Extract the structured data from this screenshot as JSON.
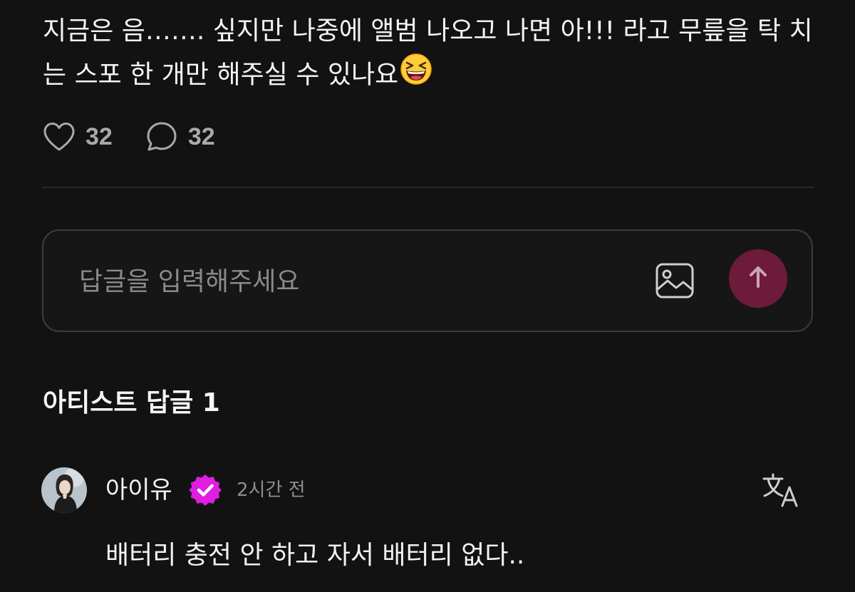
{
  "post": {
    "text": "지금은 음……. 싶지만 나중에 앨범 나오고 나면 아!!! 라고 무릎을 탁 치는  스포 한 개만 해주실 수 있나요",
    "emoji": "grinning-squinting-face-emoji"
  },
  "reactions": {
    "likes": "32",
    "comments": "32",
    "like_icon": "heart-icon",
    "comment_icon": "speech-bubble-icon"
  },
  "reply_box": {
    "placeholder": "답글을 입력해주세요",
    "image_icon": "image-icon",
    "send_icon": "arrow-up-icon",
    "send_color": "#6e1a3a"
  },
  "artist_replies": {
    "title": "아티스트 답글 1"
  },
  "comment": {
    "author": "아이유",
    "verified_icon": "verified-badge-icon",
    "verified_color": "#e01ee0",
    "time": "2시간 전",
    "translate_icon": "translate-icon",
    "text": "배터리 충전 안 하고 자서 배터리 없다.."
  }
}
